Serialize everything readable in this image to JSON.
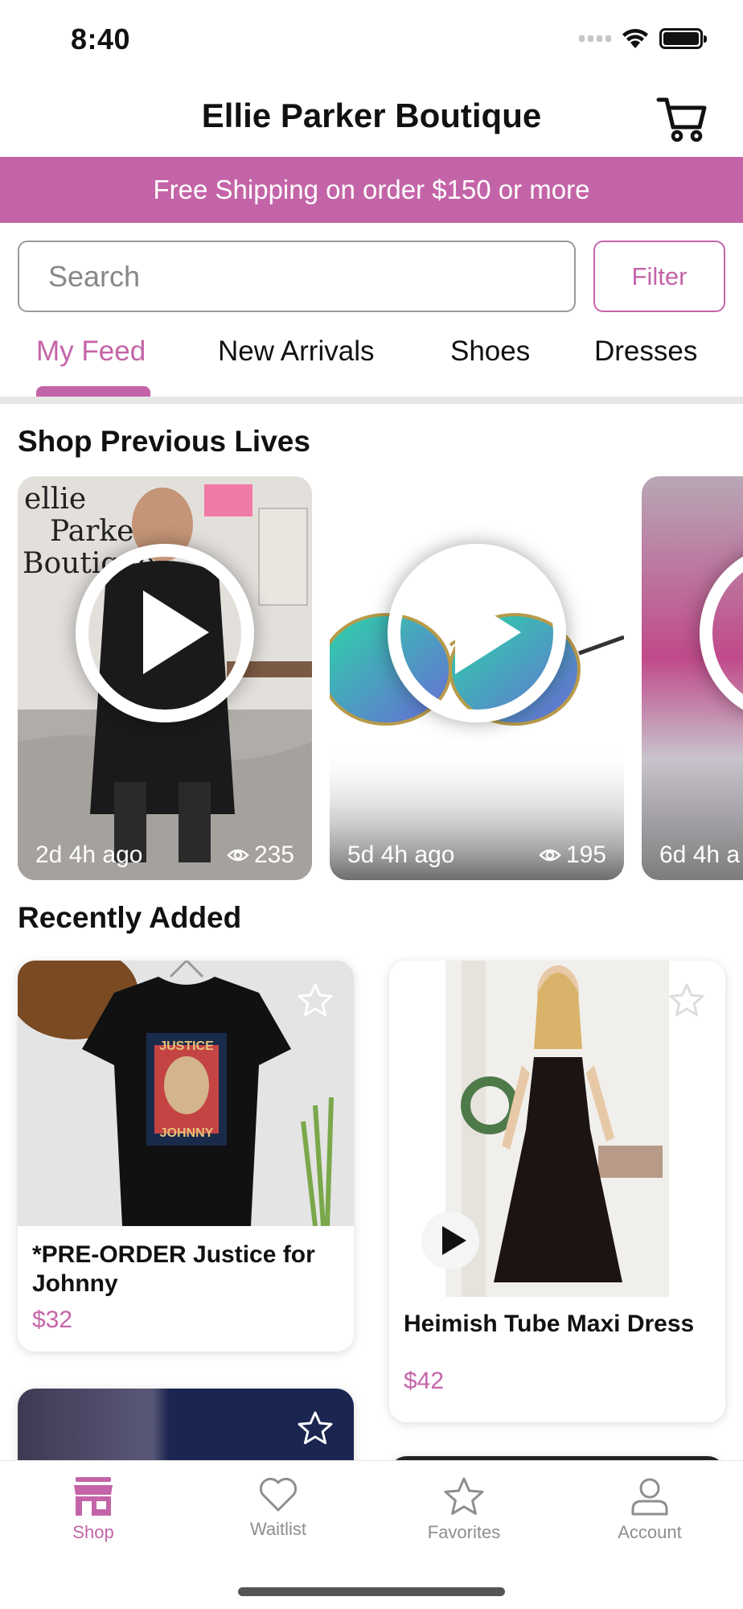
{
  "status_bar": {
    "time": "8:40"
  },
  "header": {
    "title": "Ellie Parker Boutique",
    "cart_icon": "cart-icon"
  },
  "banner": {
    "text": "Free Shipping on order $150 or more",
    "color": "#c464a8"
  },
  "search": {
    "placeholder": "Search",
    "filter_label": "Filter"
  },
  "tabs": [
    {
      "label": "My Feed",
      "active": true
    },
    {
      "label": "New Arrivals",
      "active": false
    },
    {
      "label": "Shoes",
      "active": false
    },
    {
      "label": "Dresses",
      "active": false
    }
  ],
  "lives": {
    "title": "Shop Previous Lives",
    "items": [
      {
        "ago": "2d 4h ago",
        "views": "235"
      },
      {
        "ago": "5d 4h ago",
        "views": "195"
      },
      {
        "ago": "6d 4h a",
        "views": ""
      }
    ]
  },
  "recent": {
    "title": "Recently Added",
    "products": [
      {
        "name": "*PRE-ORDER Justice for Johnny",
        "price": "$32",
        "shirt_text_top": "JUSTICE",
        "shirt_text_bottom": "JOHNNY"
      },
      {
        "name": "Heimish Tube Maxi Dress",
        "price": "$42"
      }
    ]
  },
  "nav": {
    "items": [
      {
        "label": "Shop",
        "icon": "shop-icon",
        "active": true
      },
      {
        "label": "Waitlist",
        "icon": "heart-icon",
        "active": false
      },
      {
        "label": "Favorites",
        "icon": "star-icon",
        "active": false
      },
      {
        "label": "Account",
        "icon": "account-icon",
        "active": false
      }
    ]
  },
  "colors": {
    "accent": "#c464a8",
    "inactive": "#8e8e8e"
  }
}
